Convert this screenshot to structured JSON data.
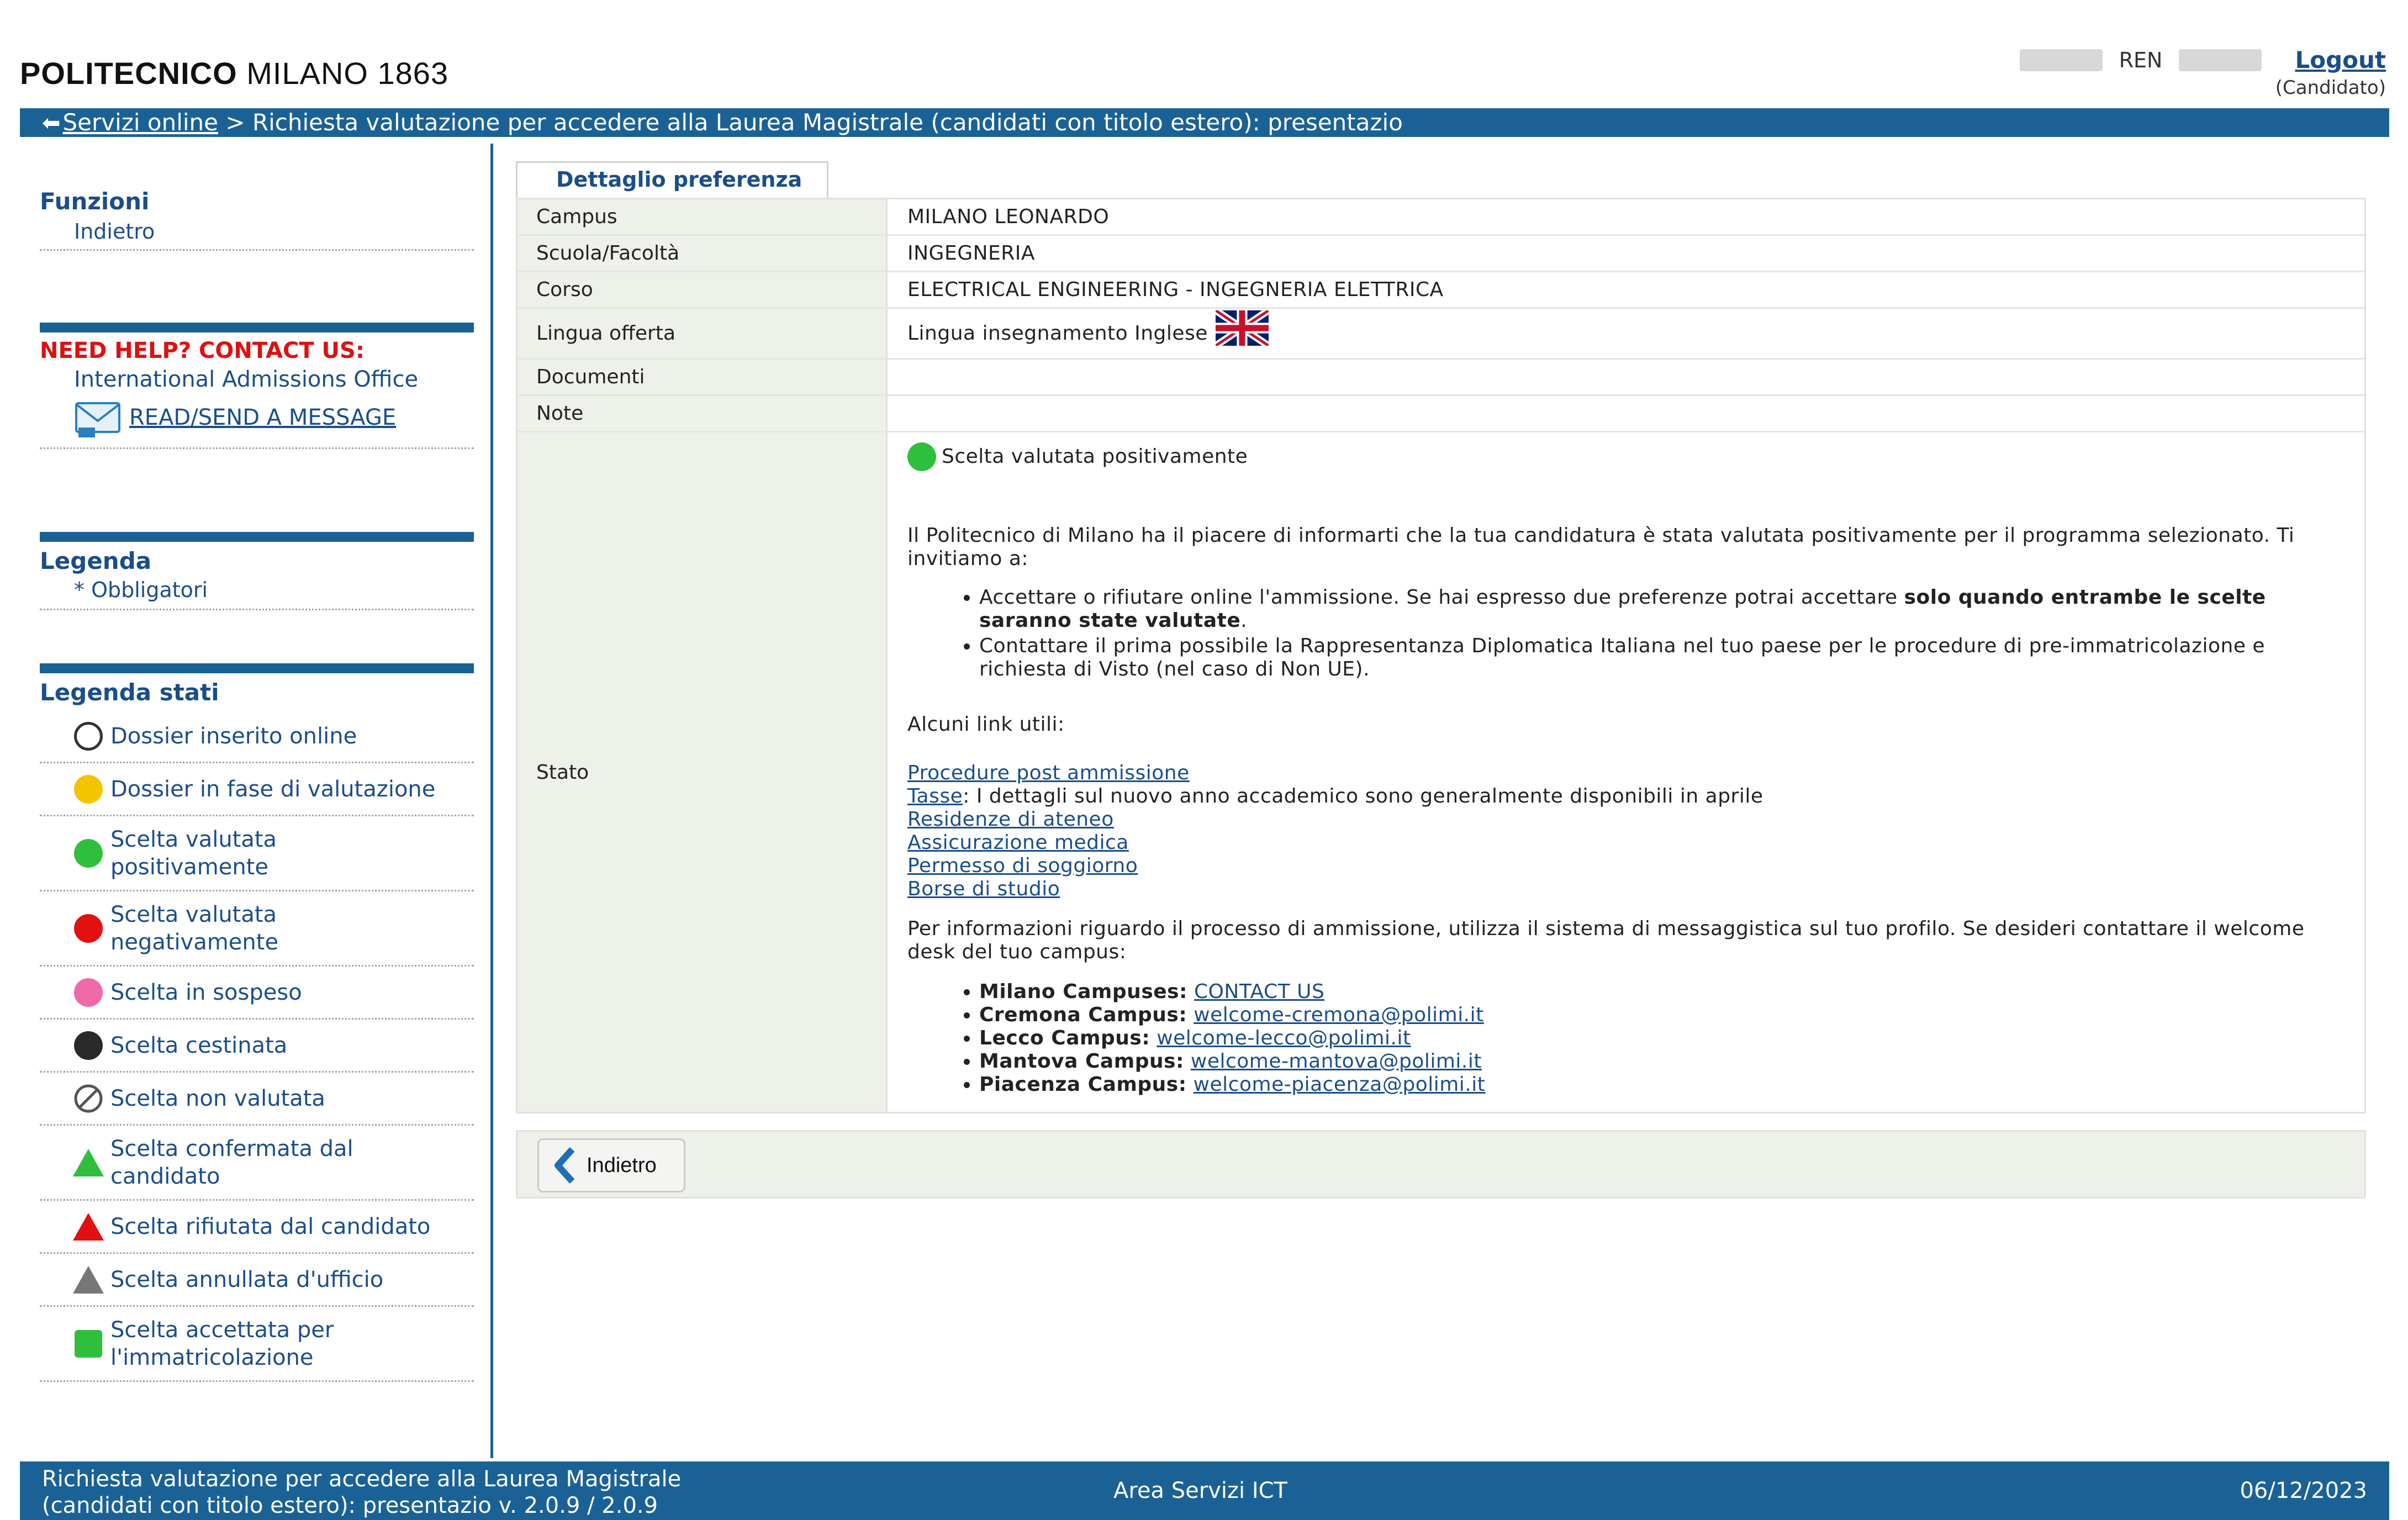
{
  "header": {
    "logo_bold": "POLITECNICO",
    "logo_rest": "MILANO 1863",
    "user_name": "REN",
    "logout_label": "Logout",
    "user_role": "(Candidato)"
  },
  "breadcrumb": {
    "back_icon": "arrow-back-icon",
    "link_label": "Servizi online",
    "current": "> Richiesta valutazione per accedere alla Laurea Magistrale (candidati con titolo estero): presentazio"
  },
  "sidebar": {
    "funzioni_title": "Funzioni",
    "funzioni_items": [
      "Indietro"
    ],
    "help_title": "NEED HELP? CONTACT US:",
    "help_office": "International Admissions Office",
    "help_link": "READ/SEND A MESSAGE",
    "legenda_title": "Legenda",
    "legenda_item": "* Obbligatori",
    "stati_title": "Legenda stati",
    "stati": [
      {
        "label": "Dossier inserito online",
        "icon": "empty-circle-icon"
      },
      {
        "label": "Dossier in fase di valutazione",
        "icon": "yellow-circle-icon"
      },
      {
        "label": "Scelta valutata positivamente",
        "icon": "green-circle-icon"
      },
      {
        "label": "Scelta valutata negativamente",
        "icon": "red-circle-icon"
      },
      {
        "label": "Scelta in sospeso",
        "icon": "pink-circle-icon"
      },
      {
        "label": "Scelta cestinata",
        "icon": "black-circle-icon"
      },
      {
        "label": "Scelta non valutata",
        "icon": "prohibited-icon"
      },
      {
        "label": "Scelta confermata dal candidato",
        "icon": "green-triangle-icon"
      },
      {
        "label": "Scelta rifiutata dal candidato",
        "icon": "red-triangle-icon"
      },
      {
        "label": "Scelta annullata d'ufficio",
        "icon": "gray-triangle-icon"
      },
      {
        "label": "Scelta accettata per l'immatricolazione",
        "icon": "green-square-icon"
      }
    ]
  },
  "colors": {
    "brand_blue": "#1a6296",
    "link_blue": "#1a4e8a",
    "help_red": "#dd1111",
    "yellow": "#f5c400",
    "green": "#2fbf3c",
    "red": "#e21010",
    "pink": "#f06aa8",
    "black": "#2a2a2a",
    "gray": "#777777"
  },
  "detail": {
    "tab_label": "Dettaglio preferenza",
    "rows": [
      {
        "label": "Campus",
        "value": "MILANO LEONARDO"
      },
      {
        "label": "Scuola/Facoltà",
        "value": "INGEGNERIA"
      },
      {
        "label": "Corso",
        "value": "ELECTRICAL ENGINEERING - INGEGNERIA ELETTRICA"
      },
      {
        "label": "Lingua offerta",
        "value": "Lingua insegnamento Inglese"
      },
      {
        "label": "Documenti",
        "value": ""
      },
      {
        "label": "Note",
        "value": ""
      }
    ],
    "flag_icon": "uk-flag-icon",
    "stato_label": "Stato",
    "stato": {
      "head": "Scelta valutata positivamente",
      "intro": "Il Politecnico di Milano ha il piacere di informarti che la tua candidatura è stata valutata positivamente per il programma selezionato. Ti invitiamo a:",
      "bullet1_pre": "Accettare o rifiutare online l'ammissione. Se hai espresso due preferenze potrai accettare ",
      "bullet1_bold": "solo quando entrambe le scelte saranno state valutate",
      "bullet1_end": ".",
      "bullet2": "Contattare il prima possibile la Rappresentanza Diplomatica Italiana nel tuo paese per le procedure di pre-immatricolazione e richiesta di Visto (nel caso di Non UE).",
      "links_title": "Alcuni link utili:",
      "link_procedure": "Procedure post ammissione",
      "link_tasse": "Tasse",
      "tasse_text": ": I dettagli sul nuovo anno accademico sono generalmente disponibili in aprile",
      "link_residenze": "Residenze di ateneo",
      "link_assicurazione": "Assicurazione medica",
      "link_permesso": "Permesso di soggiorno",
      "link_borse": "Borse di studio",
      "info": "Per informazioni riguardo il processo di ammissione, utilizza il sistema di messaggistica sul tuo profilo. Se desideri contattare il welcome desk del tuo campus:",
      "campuses": [
        {
          "name": "Milano Campuses:",
          "link": "CONTACT US "
        },
        {
          "name": "Cremona Campus:",
          "link": "welcome-cremona@polimi.it"
        },
        {
          "name": "Lecco Campus:",
          "link": "welcome-lecco@polimi.it"
        },
        {
          "name": "Mantova Campus:",
          "link": "welcome-mantova@polimi.it"
        },
        {
          "name": "Piacenza Campus:",
          "link": "welcome-piacenza@polimi.it"
        }
      ]
    },
    "back_button": "Indietro"
  },
  "footer": {
    "app_line1": "Richiesta valutazione per accedere alla Laurea Magistrale",
    "app_line2": "(candidati con titolo estero): presentazio v. 2.0.9 / 2.0.9",
    "center": "Area Servizi ICT",
    "date": "06/12/2023"
  }
}
